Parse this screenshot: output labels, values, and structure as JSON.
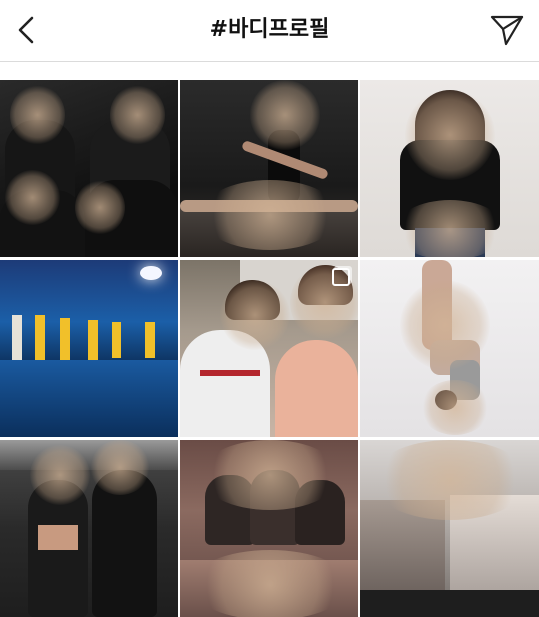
{
  "header": {
    "title": "#바디프로필",
    "back_icon": "chevron-left-icon",
    "share_icon": "paper-plane-icon"
  },
  "grid": {
    "posts": [
      {
        "id": "post-1",
        "theme": "dark-group-photo",
        "multi": false
      },
      {
        "id": "post-2",
        "theme": "dancer-black-leotard",
        "multi": false
      },
      {
        "id": "post-3",
        "theme": "woman-black-tshirt",
        "multi": false
      },
      {
        "id": "post-4",
        "theme": "boxing-gym-blue-floor",
        "multi": false
      },
      {
        "id": "post-5",
        "theme": "two-men-selfie",
        "multi": true
      },
      {
        "id": "post-6",
        "theme": "headstand-pose",
        "multi": false
      },
      {
        "id": "post-7",
        "theme": "gym-mirror-selfie",
        "multi": false
      },
      {
        "id": "post-8",
        "theme": "group-body-profile",
        "multi": false
      },
      {
        "id": "post-9",
        "theme": "abs-closeup",
        "multi": false
      }
    ]
  }
}
